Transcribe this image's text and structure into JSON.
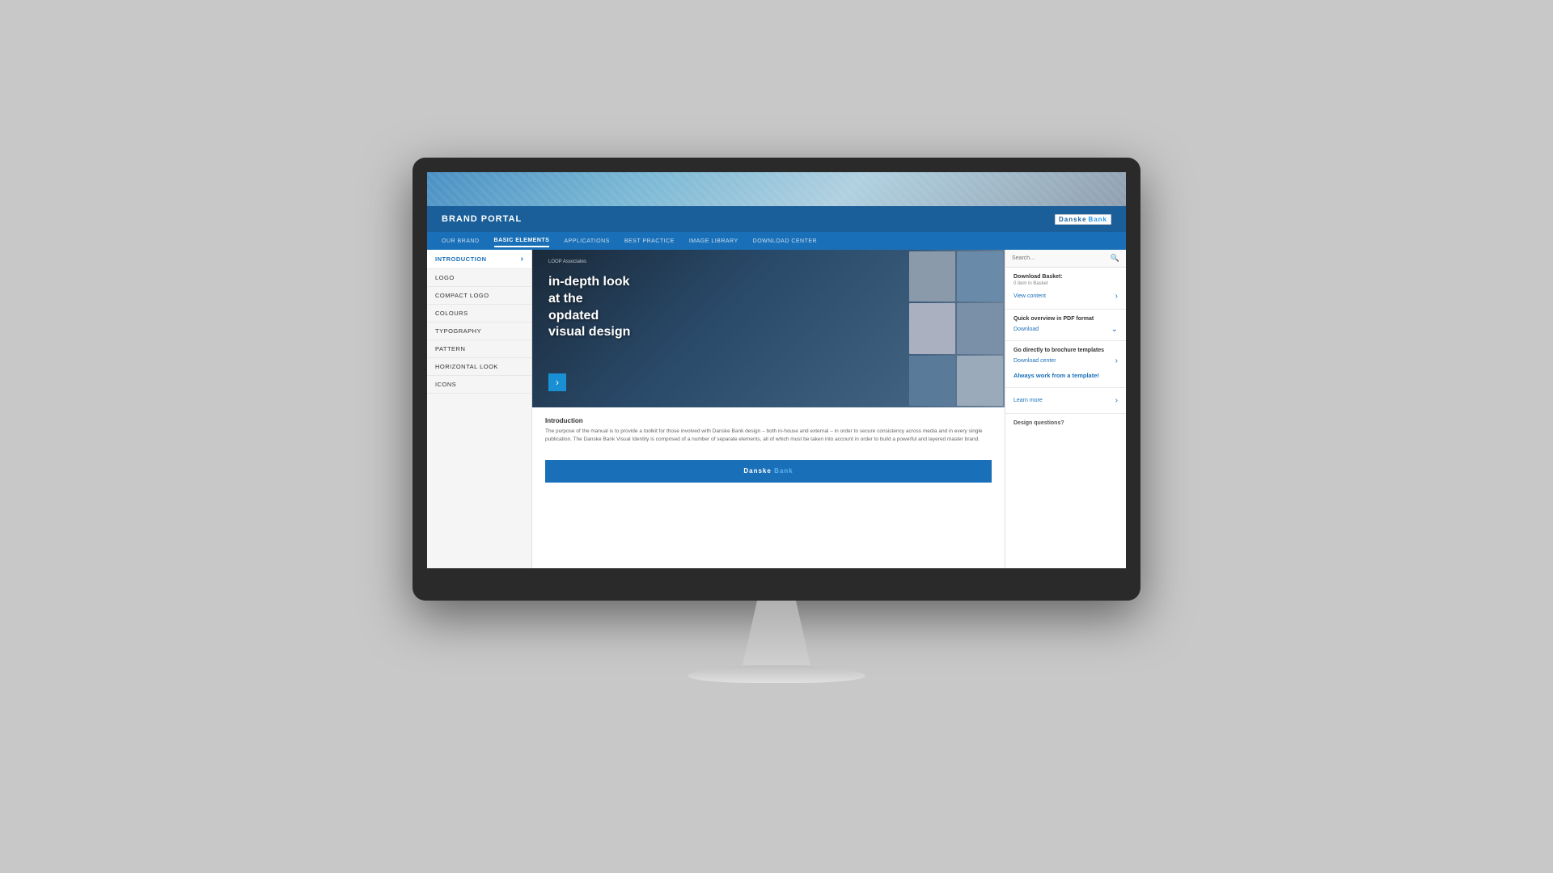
{
  "monitor": {
    "screen_label": "Brand Portal - Danske Bank"
  },
  "website": {
    "header": {
      "brand_portal_title": "BRAND PORTAL",
      "bank_logo_danske": "Danske",
      "bank_logo_bank": "Bank"
    },
    "nav": {
      "items": [
        {
          "label": "OUR BRAND",
          "active": false
        },
        {
          "label": "BASIC ELEMENTS",
          "active": true
        },
        {
          "label": "APPLICATIONS",
          "active": false
        },
        {
          "label": "BEST PRACTICE",
          "active": false
        },
        {
          "label": "IMAGE LIBRARY",
          "active": false
        },
        {
          "label": "DOWNLOAD CENTER",
          "active": false
        }
      ]
    },
    "sidebar": {
      "items": [
        {
          "label": "INTRODUCTION",
          "has_chevron": true
        },
        {
          "label": "LOGO",
          "has_chevron": false
        },
        {
          "label": "COMPACT LOGO",
          "has_chevron": false
        },
        {
          "label": "COLOURS",
          "has_chevron": false
        },
        {
          "label": "TYPOGRAPHY",
          "has_chevron": false
        },
        {
          "label": "PATTERN",
          "has_chevron": false
        },
        {
          "label": "HORIZONTAL LOOK",
          "has_chevron": false
        },
        {
          "label": "ICONS",
          "has_chevron": false
        }
      ]
    },
    "hero": {
      "label": "LOOP Associates",
      "title_line1": "in-depth look",
      "title_line2": "at the",
      "title_line3": "opdated",
      "title_line4": "visual design"
    },
    "intro": {
      "title": "Introduction",
      "text": "The purpose of the manual is to provide a toolkit for those involved with Danske Bank design – both in-house and external – in order to secure consistency across media and in every single publication. The Danske Bank Visual Identity is comprised of a number of separate elements, all of which must be taken into account in order to build a powerful and layered master brand."
    },
    "template_banner": {
      "danske": "Danske",
      "bank": "Bank"
    },
    "right_sidebar": {
      "search_placeholder": "Search...",
      "download_basket": {
        "title": "Download Basket:",
        "sub": "0 item in Basket",
        "view_content_label": "View content"
      },
      "quick_overview": {
        "title": "Quick overview in PDF format",
        "download_label": "Download"
      },
      "go_directly": {
        "title": "Go directly to brochure templates",
        "download_center_label": "Download center"
      },
      "always_work": {
        "highlight": "Always work from a template!",
        "learn_more_label": "Learn more"
      },
      "design_questions": "Design questions?"
    }
  }
}
